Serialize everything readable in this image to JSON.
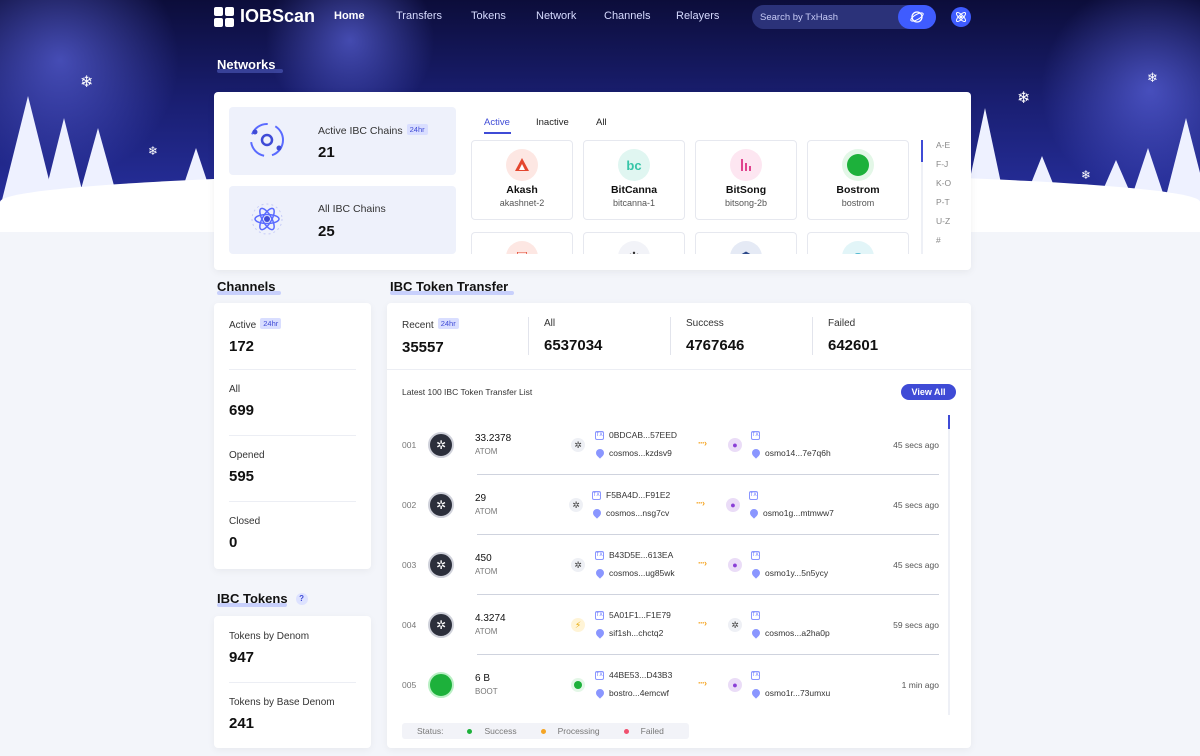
{
  "nav": {
    "brand": "IOBScan",
    "links": [
      "Home",
      "Transfers",
      "Tokens",
      "Network",
      "Channels",
      "Relayers"
    ],
    "search_placeholder": "Search by TxHash"
  },
  "networks": {
    "title": "Networks",
    "active_label": "Active IBC Chains",
    "active_badge": "24hr",
    "active_value": "21",
    "all_label": "All IBC Chains",
    "all_value": "25",
    "tabs": [
      "Active",
      "Inactive",
      "All"
    ],
    "chains": [
      {
        "name": "Akash",
        "id": "akashnet-2",
        "color": "#e4472f",
        "icon": "akash-icon"
      },
      {
        "name": "BitCanna",
        "id": "bitcanna-1",
        "color": "#36c5a8",
        "icon": "bitcanna-icon"
      },
      {
        "name": "BitSong",
        "id": "bitsong-2b",
        "color": "#e0448e",
        "icon": "bitsong-icon"
      },
      {
        "name": "Bostrom",
        "id": "bostrom",
        "color": "#1db13b",
        "icon": "bostrom-icon"
      }
    ],
    "alpha_index": [
      "A-E",
      "F-J",
      "K-O",
      "P-T",
      "U-Z",
      "#"
    ]
  },
  "channels": {
    "title": "Channels",
    "items": [
      {
        "label": "Active",
        "badge": "24hr",
        "value": "172"
      },
      {
        "label": "All",
        "value": "699"
      },
      {
        "label": "Opened",
        "value": "595"
      },
      {
        "label": "Closed",
        "value": "0"
      }
    ]
  },
  "ibc_tokens": {
    "title": "IBC Tokens",
    "help": "?",
    "items": [
      {
        "label": "Tokens by Denom",
        "value": "947"
      },
      {
        "label": "Tokens by Base Denom",
        "value": "241"
      }
    ]
  },
  "transfer": {
    "title": "IBC Token Transfer",
    "stats": [
      {
        "label": "Recent",
        "badge": "24hr",
        "value": "35557"
      },
      {
        "label": "All",
        "value": "6537034"
      },
      {
        "label": "Success",
        "value": "4767646"
      },
      {
        "label": "Failed",
        "value": "642601"
      }
    ],
    "list_title": "Latest 100 IBC Token Transfer List",
    "view_all": "View All",
    "rows": [
      {
        "idx": "001",
        "amount": "33.2378",
        "denom": "ATOM",
        "tx": "0BDCAB...57EED",
        "from": "cosmos...kzdsv9",
        "to": "osmo14...7e7q6h",
        "time": "45 secs ago"
      },
      {
        "idx": "002",
        "amount": "29",
        "denom": "ATOM",
        "tx": "F5BA4D...F91E2",
        "from": "cosmos...nsg7cv",
        "to": "osmo1g...mtmww7",
        "time": "45 secs ago"
      },
      {
        "idx": "003",
        "amount": "450",
        "denom": "ATOM",
        "tx": "B43D5E...613EA",
        "from": "cosmos...ug85wk",
        "to": "osmo1y...5n5ycy",
        "time": "45 secs ago"
      },
      {
        "idx": "004",
        "amount": "4.3274",
        "denom": "ATOM",
        "tx": "5A01F1...F1E79",
        "from": "sif1sh...chctq2",
        "to": "cosmos...a2ha0p",
        "time": "59 secs ago"
      },
      {
        "idx": "005",
        "amount": "6 B",
        "denom": "BOOT",
        "tx": "44BE53...D43B3",
        "from": "bostro...4emcwf",
        "to": "osmo1r...73umxu",
        "time": "1 min ago"
      }
    ],
    "legend": {
      "label": "Status:",
      "success": "Success",
      "processing": "Processing",
      "failed": "Failed"
    },
    "colors": {
      "success": "#1db13b",
      "processing": "#f5a524",
      "failed": "#f0506e"
    }
  }
}
